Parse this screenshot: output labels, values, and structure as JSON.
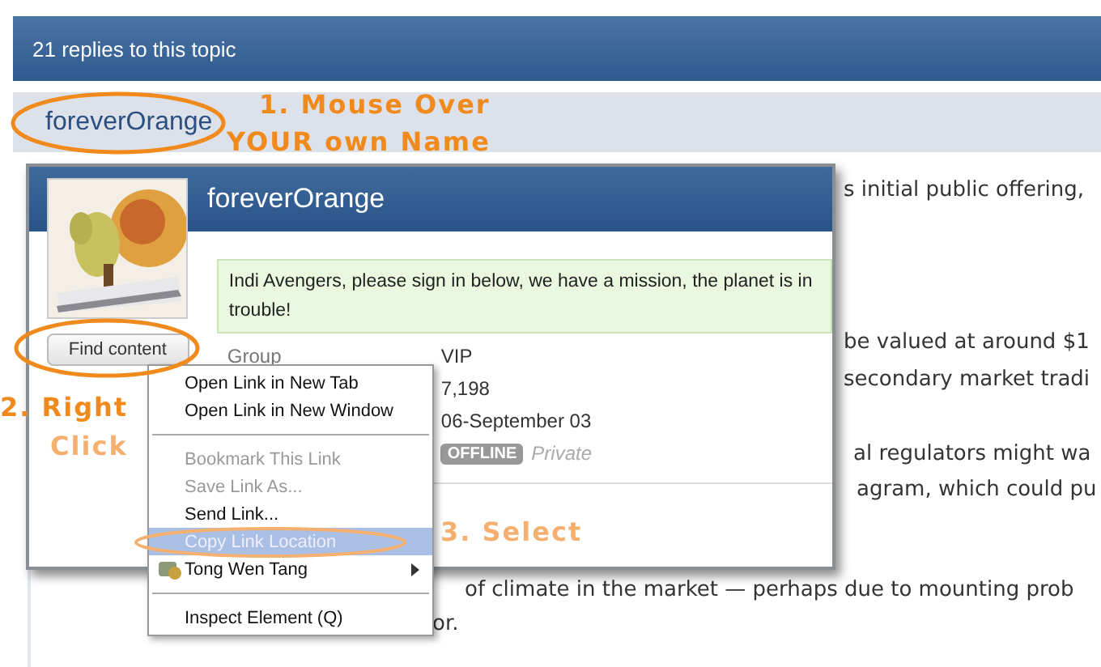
{
  "topic_bar": {
    "text": "21 replies to this topic"
  },
  "author": {
    "name": "foreverOrange"
  },
  "post_lines": [
    "s initial public offering,",
    "be valued at around $1",
    "secondary market tradi",
    "al regulators might wa",
    "agram, which could pu",
    "of climate in the market — perhaps due to mounting prob",
    "or."
  ],
  "profile_card": {
    "name": "foreverOrange",
    "status_message": "Indi Avengers, please sign in below, we have a mission, the planet is in trouble!",
    "find_button": "Find content",
    "rows": [
      {
        "label": "Group",
        "value": "VIP"
      },
      {
        "value": "7,198"
      },
      {
        "value": "06-September 03"
      }
    ],
    "badge": "OFFLINE",
    "privacy": "Private"
  },
  "context_menu": [
    {
      "kind": "item",
      "label": "Open Link in New Tab",
      "disabled": false,
      "selected": false
    },
    {
      "kind": "item",
      "label": "Open Link in New Window",
      "disabled": false,
      "selected": false
    },
    {
      "kind": "separator"
    },
    {
      "kind": "item",
      "label": "Bookmark This Link",
      "disabled": true,
      "selected": false
    },
    {
      "kind": "item",
      "label": "Save Link As...",
      "disabled": true,
      "selected": false
    },
    {
      "kind": "item",
      "label": "Send Link...",
      "disabled": false,
      "selected": false
    },
    {
      "kind": "item",
      "label": "Copy Link Location",
      "disabled": false,
      "selected": true
    },
    {
      "kind": "addon",
      "label": "Tong Wen Tang",
      "disabled": false,
      "selected": false
    },
    {
      "kind": "separator"
    },
    {
      "kind": "item",
      "label": "Inspect Element (Q)",
      "disabled": false,
      "selected": false
    }
  ],
  "annotations": [
    "1. Mouse Over",
    "YOUR own Name",
    "2. Right",
    "Click",
    "3. Select"
  ]
}
